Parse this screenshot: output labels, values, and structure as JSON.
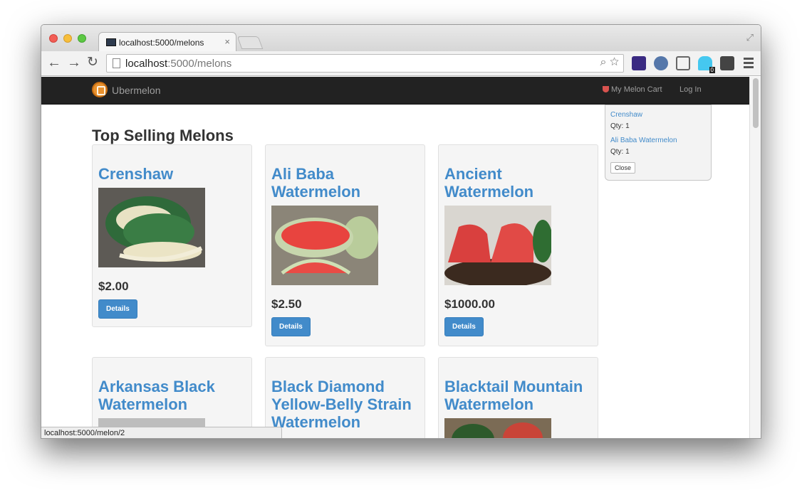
{
  "browser": {
    "tab_title": "localhost:5000/melons",
    "tab_close": "×",
    "url_host": "localhost",
    "url_rest": ":5000/melons",
    "status_url": "localhost:5000/melon/2",
    "extension_badge": "0"
  },
  "navbar": {
    "brand": "Ubermelon",
    "cart_label": "My Melon Cart",
    "login_label": "Log In"
  },
  "cart_popover": {
    "items": [
      {
        "name": "Crenshaw",
        "qty": "Qty: 1"
      },
      {
        "name": "Ali Baba Watermelon",
        "qty": "Qty: 1"
      }
    ],
    "close_label": "Close"
  },
  "main": {
    "heading": "Top Selling Melons",
    "details_label": "Details",
    "melons": [
      {
        "name": "Crenshaw",
        "price": "$2.00"
      },
      {
        "name": "Ali Baba Watermelon",
        "price": "$2.50"
      },
      {
        "name": "Ancient Watermelon",
        "price": "$1000.00"
      },
      {
        "name": "Arkansas Black Watermelon"
      },
      {
        "name": "Black Diamond Yellow-Belly Strain Watermelon"
      },
      {
        "name": "Blacktail Mountain Watermelon"
      }
    ]
  }
}
